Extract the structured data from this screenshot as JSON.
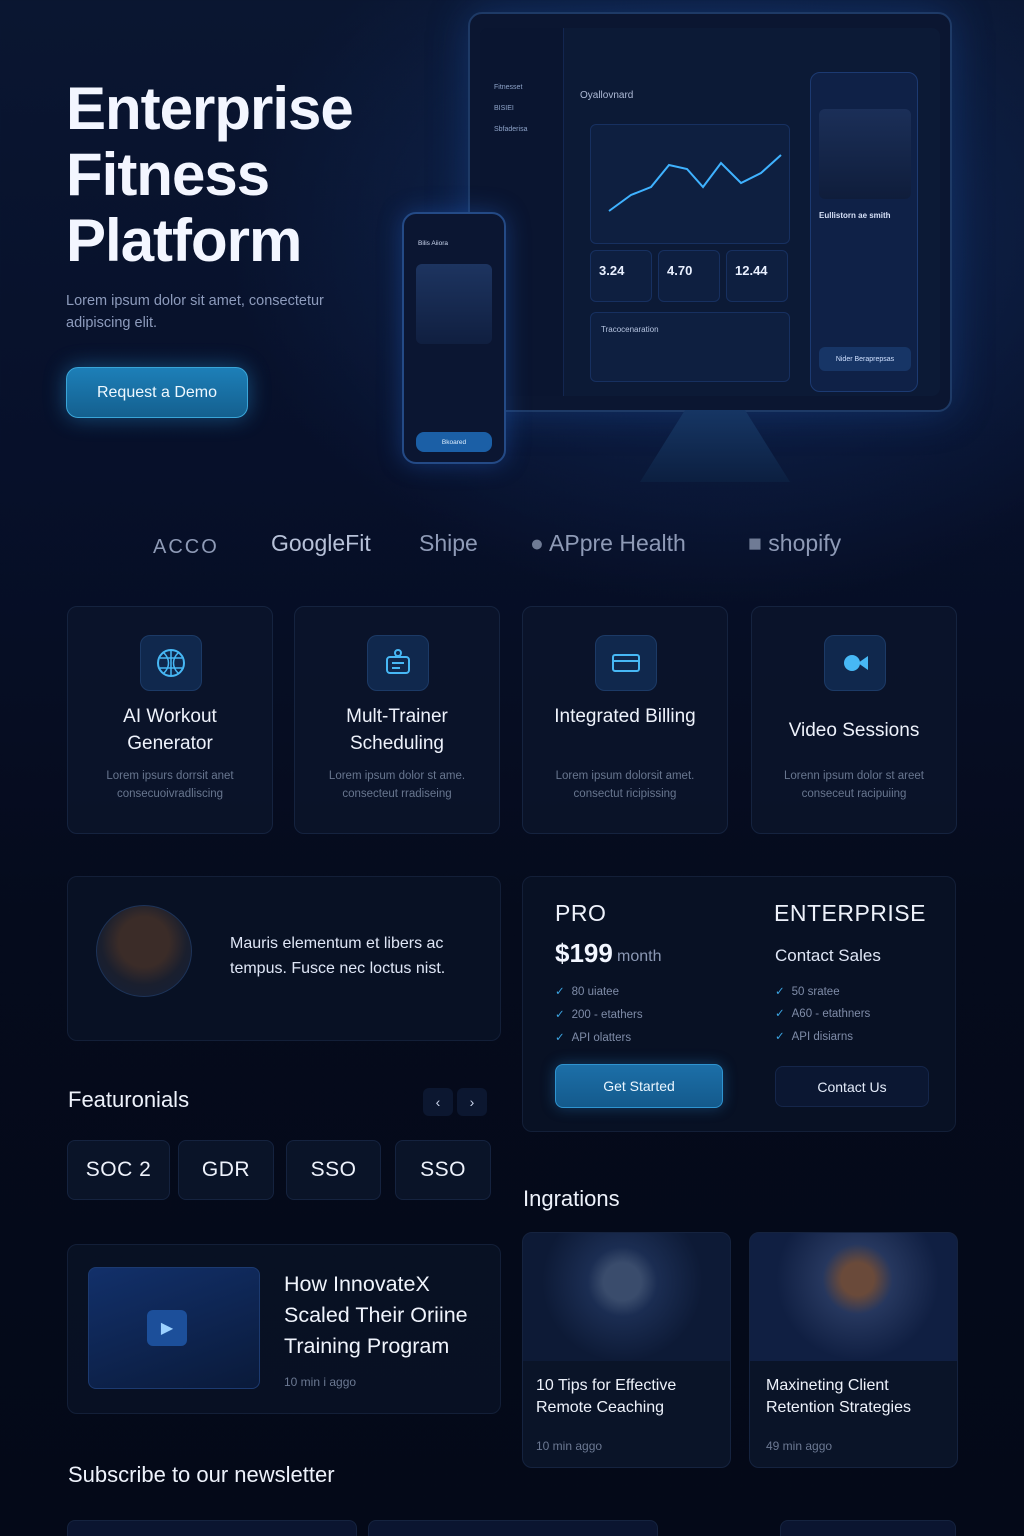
{
  "hero": {
    "title_lines": [
      "Enterprise",
      "Fitness",
      "Platform"
    ],
    "subtitle": "Lorem ipsum dolor sit amet, consectetur adipiscing elit.",
    "cta_label": "Request a Demo"
  },
  "mockup": {
    "monitor_title": "Oyallovnard",
    "sidebar_items": [
      "Fitnesset",
      "BISIEI",
      "Sbfaderisa"
    ],
    "stats": [
      "3.24",
      "4.70",
      "12.44"
    ],
    "sessions_label": "Tracocenaration",
    "trainer_caption": "Eullistorn ae smith",
    "trainer_button": "Nider Beraprepsas",
    "phone_header": "Bilis Aiiora",
    "phone_button": "Bkoared"
  },
  "partners": [
    "ACCO",
    "GoogleFit",
    "Shipe",
    "APpre Health",
    "shopify"
  ],
  "features": [
    {
      "title": "AI Workout Generator",
      "desc": "Lorem ipsurs dorrsit anet consecuoivradliscing",
      "icon": "brain-icon"
    },
    {
      "title": "Mult-Trainer Scheduling",
      "desc": "Lorem ipsum dolor st ame. consecteut rradiseing",
      "icon": "schedule-icon"
    },
    {
      "title": "Integrated Billing",
      "desc": "Lorem ipsum dolorsit amet. consectut ricipissing",
      "icon": "card-icon"
    },
    {
      "title": "Video Sessions",
      "desc": "Lorenn ipsum dolor st areet conseceut racipuiing",
      "icon": "video-icon"
    }
  ],
  "testimonial": {
    "quote": "Mauris elementum et libers ac tempus. Fusce nec loctus nist."
  },
  "pricing": {
    "pro": {
      "name": "PRO",
      "price": "$199",
      "period": "month",
      "features": [
        "80 uiatee",
        "200 - etathers",
        "API olatters"
      ],
      "button": "Get Started"
    },
    "enterprise": {
      "name": "ENTERPRISE",
      "tagline": "Contact Sales",
      "features": [
        "50 sratee",
        "A60 - etathners",
        "API disiarns"
      ],
      "button": "Contact Us"
    }
  },
  "featurionials": {
    "title": "Featuronials",
    "badges": [
      "SOC 2",
      "GDR",
      "SSO",
      "SSO"
    ]
  },
  "case_study": {
    "title": "How InnovateX Scaled Their Oriine Training Program",
    "meta": "10 min i aggo"
  },
  "ingrations": {
    "title": "Ingrations",
    "cards": [
      {
        "title": "10 Tips for Effective Remote Ceaching",
        "meta": "10 min aggo"
      },
      {
        "title": "Maxineting Client Retention Strategies",
        "meta": "49 min aggo"
      }
    ]
  },
  "newsletter": {
    "title": "Subscribe to our newsletter"
  },
  "colors": {
    "accent": "#1d7fb8",
    "background": "#060c1d",
    "check": "#3ba3e0"
  }
}
